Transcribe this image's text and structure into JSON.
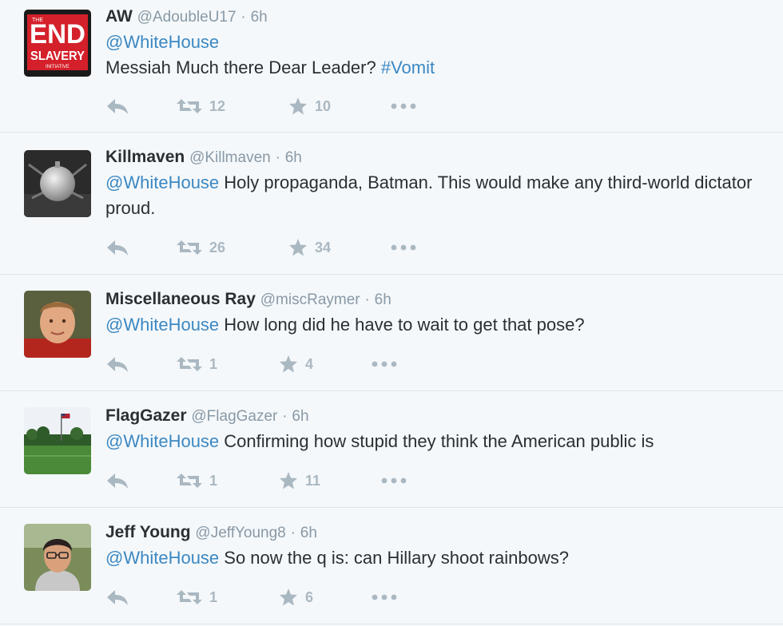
{
  "tweets": [
    {
      "name": "AW",
      "handle": "@AdoubleU17",
      "sep": "·",
      "time": "6h",
      "mention": "@WhiteHouse",
      "text": "Messiah Much there Dear Leader? ",
      "hashtag": "#Vomit",
      "retweets": "12",
      "favorites": "10",
      "avatar_text": {
        "end": "END",
        "slavery": "SLAVERY",
        "small": "THE",
        "initiative": "INITIATIVE"
      }
    },
    {
      "name": "Killmaven",
      "handle": "@Killmaven",
      "sep": "·",
      "time": "6h",
      "mention": "@WhiteHouse",
      "text": " Holy propaganda, Batman. This would make any third-world dictator proud.",
      "retweets": "26",
      "favorites": "34"
    },
    {
      "name": "Miscellaneous Ray",
      "handle": "@miscRaymer",
      "sep": "·",
      "time": "6h",
      "mention": "@WhiteHouse",
      "text": " How long did he have to wait to get that pose?",
      "retweets": "1",
      "favorites": "4"
    },
    {
      "name": "FlagGazer",
      "handle": "@FlagGazer",
      "sep": "·",
      "time": "6h",
      "mention": "@WhiteHouse",
      "text": " Confirming how stupid they think the American public is",
      "retweets": "1",
      "favorites": "11"
    },
    {
      "name": "Jeff Young",
      "handle": "@JeffYoung8",
      "sep": "·",
      "time": "6h",
      "mention": "@WhiteHouse",
      "text": " So now the q is: can Hillary shoot rainbows?",
      "retweets": "1",
      "favorites": "6"
    }
  ],
  "colors": {
    "link": "#3b88c3",
    "muted": "#8899a6",
    "icon": "#aab8c2",
    "background": "#f5f8fa"
  }
}
